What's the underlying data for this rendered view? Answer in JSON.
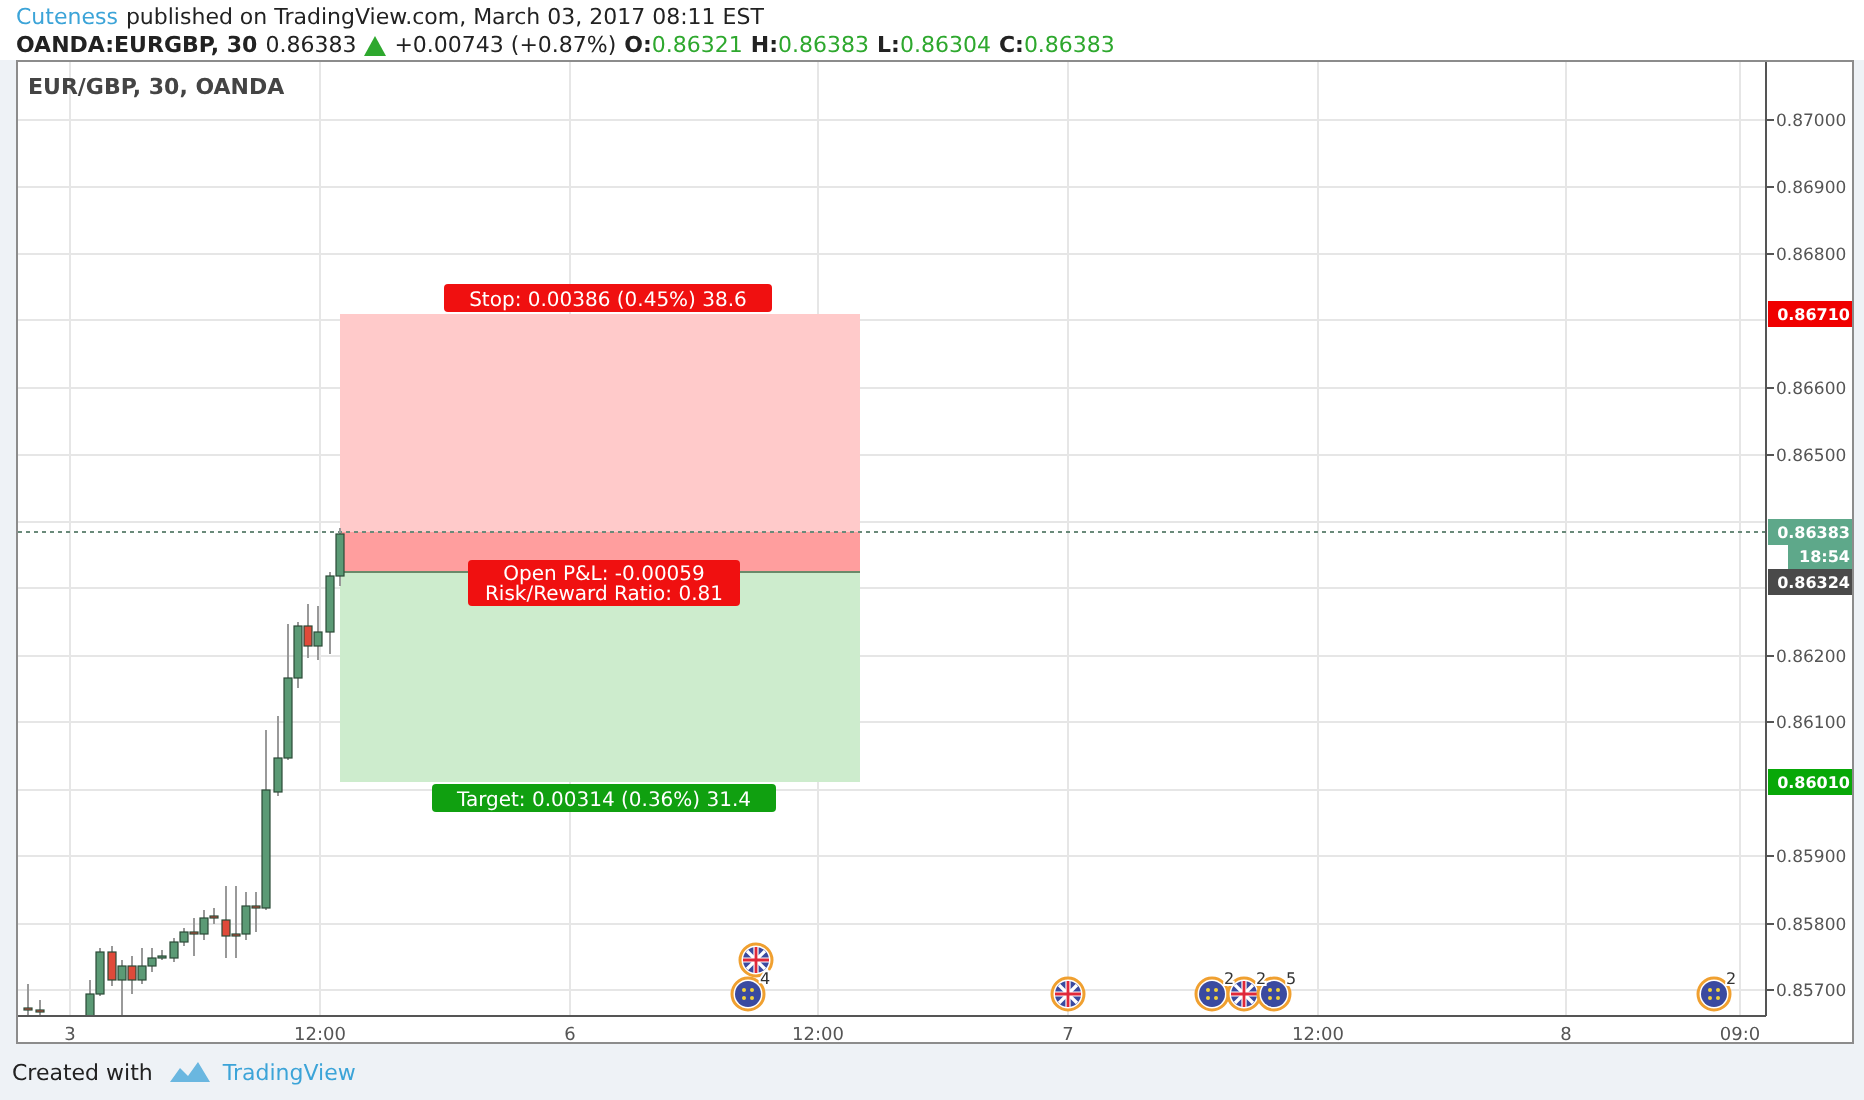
{
  "header": {
    "author": "Cuteness",
    "published": "published on TradingView.com, March 03, 2017 08:11 EST"
  },
  "quote": {
    "symbol": "OANDA:EURGBP, 30",
    "last": "0.86383",
    "change": "+0.00743 (+0.87%)",
    "ohlc": [
      {
        "label": "O:",
        "value": "0.86321"
      },
      {
        "label": "H:",
        "value": "0.86383"
      },
      {
        "label": "L:",
        "value": "0.86304"
      },
      {
        "label": "C:",
        "value": "0.86383"
      }
    ]
  },
  "chart": {
    "legend": "EUR/GBP, 30, OANDA",
    "price_ticks": [
      "0.87000",
      "0.86900",
      "0.86800",
      "0.86600",
      "0.86500",
      "0.86200",
      "0.86100",
      "0.85900",
      "0.85800",
      "0.85700"
    ],
    "time_ticks": [
      "3",
      "12:00",
      "6",
      "12:00",
      "7",
      "12:00",
      "8",
      "09:0"
    ],
    "position": {
      "stop_label": "Stop: 0.00386 (0.45%) 38.6",
      "pnl_label": "Open P&L: -0.00059",
      "rr_label": "Risk/Reward Ratio: 0.81",
      "target_label": "Target: 0.00314 (0.36%) 31.4"
    },
    "price_badges": [
      {
        "kind": "stop",
        "text": "0.86710"
      },
      {
        "kind": "last",
        "text": "0.86383"
      },
      {
        "kind": "timer",
        "text": "18:54"
      },
      {
        "kind": "entry",
        "text": "0.86324"
      },
      {
        "kind": "target",
        "text": "0.86010"
      }
    ],
    "events": [
      {
        "kind": "uk"
      },
      {
        "kind": "eu",
        "count": "4"
      },
      {
        "kind": "uk"
      },
      {
        "kind": "eu",
        "count": "2"
      },
      {
        "kind": "uk",
        "count": "2"
      },
      {
        "kind": "eu",
        "count": "5"
      },
      {
        "kind": "eu",
        "count": "2"
      }
    ]
  },
  "footer": {
    "created": "Created with",
    "brand": "TradingView"
  }
}
